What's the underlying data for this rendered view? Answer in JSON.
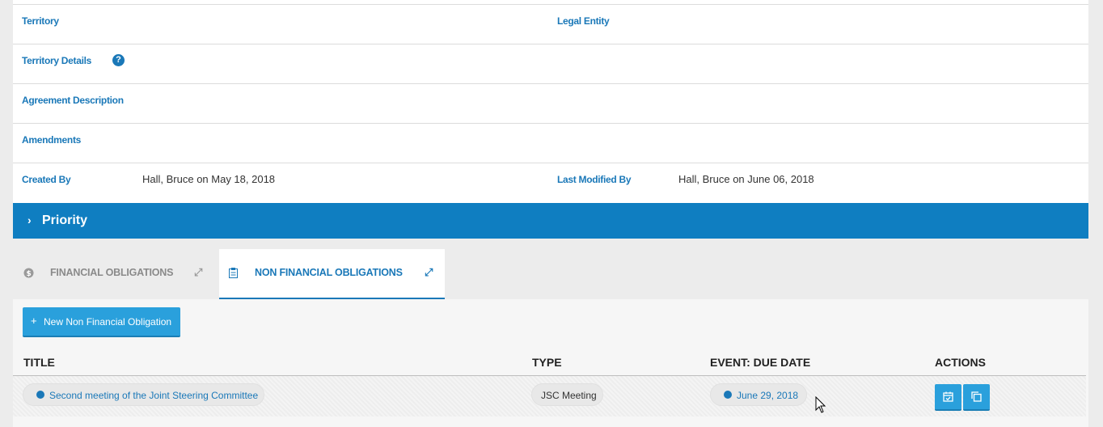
{
  "details": {
    "territory_label": "Territory",
    "legal_entity_label": "Legal Entity",
    "territory_details_label": "Territory Details",
    "agreement_description_label": "Agreement Description",
    "amendments_label": "Amendments",
    "created_by_label": "Created By",
    "created_by_value": "Hall, Bruce on May 18, 2018",
    "last_modified_label": "Last Modified By",
    "last_modified_value": "Hall, Bruce on June 06, 2018",
    "help_glyph": "?"
  },
  "priority": {
    "chevron": "›",
    "title": "Priority"
  },
  "tabs": [
    {
      "label": "FINANCIAL OBLIGATIONS",
      "icon": "dollar-icon",
      "active": false
    },
    {
      "label": "NON FINANCIAL OBLIGATIONS",
      "icon": "clipboard-icon",
      "active": true
    }
  ],
  "toolbar": {
    "new_button_label": "New Non Financial Obligation",
    "plus": "+"
  },
  "table": {
    "columns": [
      "TITLE",
      "TYPE",
      "EVENT: DUE DATE",
      "ACTIONS"
    ],
    "rows": [
      {
        "title": "Second meeting of the Joint Steering Committee",
        "type": "JSC Meeting",
        "due_date": "June 29, 2018",
        "actions": [
          "calendar-check-icon",
          "copy-icon"
        ]
      }
    ]
  },
  "colors": {
    "accent": "#1a78b8",
    "priority_bar": "#0f7ec1",
    "button": "#2aa0dc"
  }
}
